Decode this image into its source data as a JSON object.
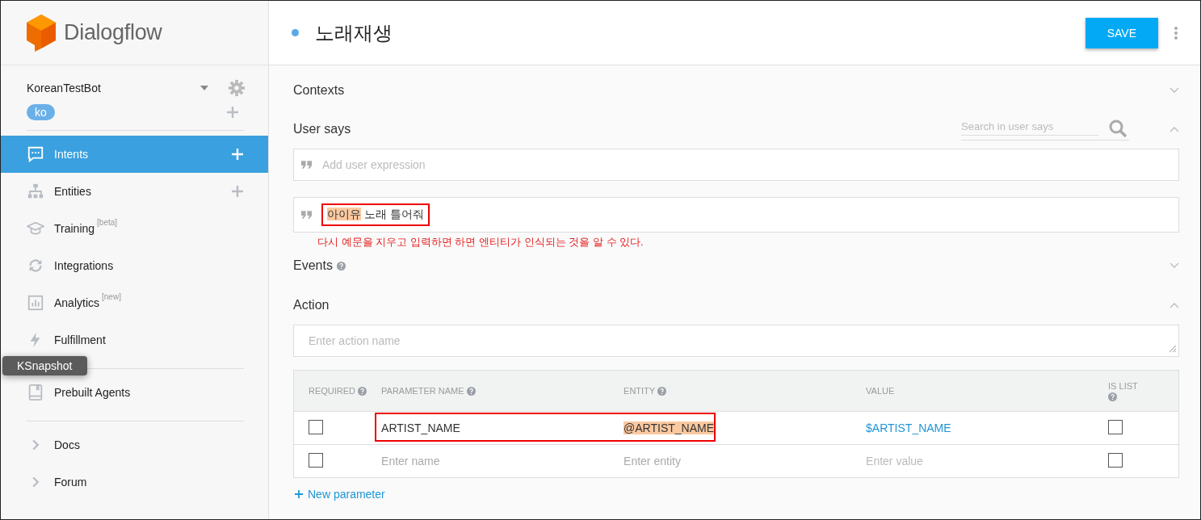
{
  "sidebar": {
    "brand": "Dialogflow",
    "agent": "KoreanTestBot",
    "language": "ko",
    "items": [
      {
        "kind": "intents",
        "label": "Intents",
        "selected": true,
        "add": true
      },
      {
        "kind": "entities",
        "label": "Entities",
        "selected": false,
        "add": true
      },
      {
        "kind": "training",
        "label": "Training",
        "sup": "[beta]",
        "selected": false,
        "add": false
      },
      {
        "kind": "integrations",
        "label": "Integrations",
        "selected": false,
        "add": false
      },
      {
        "kind": "analytics",
        "label": "Analytics",
        "sup": "[new]",
        "selected": false,
        "add": false
      },
      {
        "kind": "fulfillment",
        "label": "Fulfillment",
        "selected": false,
        "add": false
      },
      {
        "kind": "prebuilt",
        "label": "Prebuilt Agents",
        "selected": false,
        "add": false
      },
      {
        "kind": "docs",
        "label": "Docs",
        "selected": false,
        "add": false
      },
      {
        "kind": "forum",
        "label": "Forum",
        "selected": false,
        "add": false
      }
    ]
  },
  "tooltip": "KSnapshot",
  "header": {
    "title": "노래재생",
    "save": "SAVE"
  },
  "sections": {
    "contexts": "Contexts",
    "user_says": "User says",
    "search_placeholder": "Search in user says",
    "add_placeholder": "Add user expression",
    "expressions": [
      {
        "annotated": true,
        "parts": [
          {
            "text": "아이유",
            "entity": true
          },
          {
            "text": " 노래 틀어줘",
            "entity": false
          }
        ]
      }
    ],
    "note": "다시 예문을 지우고 입력하면 하면 엔티티가 인식되는 것을 알 수 있다.",
    "events": "Events",
    "action": "Action",
    "action_placeholder": "Enter action name"
  },
  "table": {
    "columns": [
      {
        "label": "REQUIRED",
        "help": true
      },
      {
        "label": "PARAMETER NAME",
        "help": true
      },
      {
        "label": "ENTITY",
        "help": true
      },
      {
        "label": "VALUE",
        "help": false
      },
      {
        "label": "IS LIST",
        "help": true
      }
    ],
    "rows": [
      {
        "required": false,
        "name": "ARTIST_NAME",
        "entity": "@ARTIST_NAME",
        "value": "$ARTIST_NAME",
        "is_list": false,
        "annotated": true
      },
      {
        "required": false,
        "name_placeholder": "Enter name",
        "entity_placeholder": "Enter entity",
        "value_placeholder": "Enter value",
        "is_list": false,
        "annotated": false
      }
    ],
    "new_parameter": "New parameter"
  }
}
